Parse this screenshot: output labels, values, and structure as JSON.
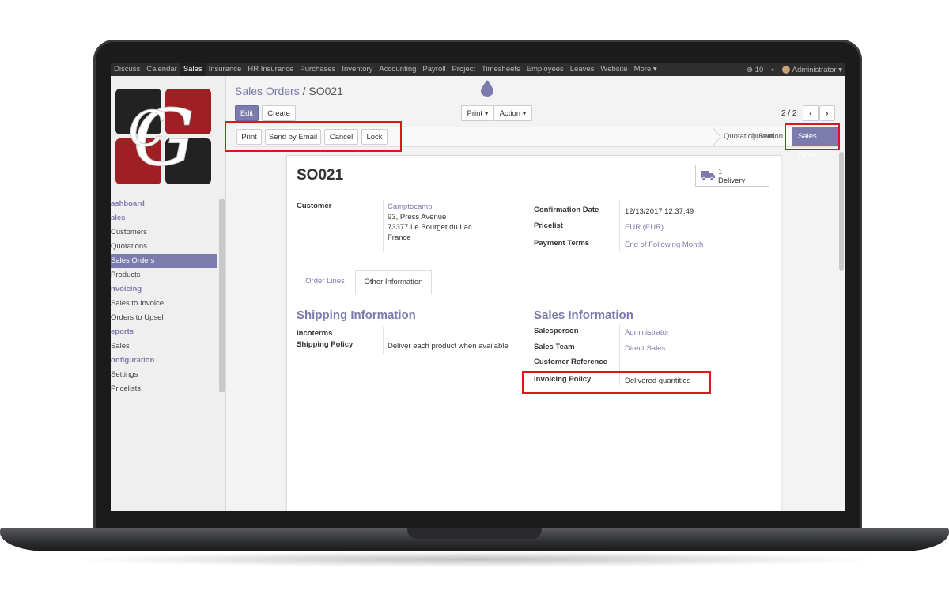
{
  "topnav": {
    "items": [
      "Discuss",
      "Calendar",
      "Sales",
      "Insurance",
      "HR Insurance",
      "Purchases",
      "Inventory",
      "Accounting",
      "Payroll",
      "Project",
      "Timesheets",
      "Employees",
      "Leaves",
      "Website",
      "More ▾"
    ],
    "active": "Sales",
    "messages_count": "10",
    "user": "Administrator ▾"
  },
  "sidebar": {
    "menu": [
      {
        "type": "section",
        "label": "ashboard"
      },
      {
        "type": "section",
        "label": "ales"
      },
      {
        "type": "link",
        "label": "Customers"
      },
      {
        "type": "link",
        "label": "Quotations"
      },
      {
        "type": "link",
        "label": "Sales Orders",
        "active": true
      },
      {
        "type": "link",
        "label": "Products"
      },
      {
        "type": "section",
        "label": "nvoicing"
      },
      {
        "type": "link",
        "label": "Sales to Invoice"
      },
      {
        "type": "link",
        "label": "Orders to Upsell"
      },
      {
        "type": "section",
        "label": "eports"
      },
      {
        "type": "link",
        "label": "Sales"
      },
      {
        "type": "section",
        "label": "onfiguration"
      },
      {
        "type": "link",
        "label": "Settings"
      },
      {
        "type": "link",
        "label": "Pricelists"
      }
    ]
  },
  "breadcrumb": {
    "parent": "Sales Orders",
    "sep": " / ",
    "current": "SO021"
  },
  "control": {
    "edit": "Edit",
    "create": "Create",
    "print": "Print ▾",
    "action": "Action ▾",
    "pager": "2 / 2",
    "prev": "‹",
    "next": "›"
  },
  "statusbar": {
    "buttons": [
      "Print",
      "Send by Email",
      "Cancel",
      "Lock"
    ],
    "stages": [
      "Quotation",
      "Quotation Sent",
      "Sales Order"
    ],
    "active_stage": "Sales Order"
  },
  "sheet": {
    "title": "SO021",
    "delivery_count": "1",
    "delivery_label": "Delivery",
    "customer_label": "Customer",
    "customer_name": "Camptocamp",
    "customer_address": [
      "93, Press Avenue",
      "73377 Le Bourget du Lac",
      "France"
    ],
    "confirmation_label": "Confirmation Date",
    "confirmation_value": "12/13/2017 12:37:49",
    "pricelist_label": "Pricelist",
    "pricelist_value": "EUR (EUR)",
    "payment_label": "Payment Terms",
    "payment_value": "End of Following Month",
    "tabs": [
      "Order Lines",
      "Other Information"
    ],
    "active_tab": "Other Information",
    "shipping": {
      "title": "Shipping Information",
      "incoterms_label": "Incoterms",
      "policy_label": "Shipping Policy",
      "policy_value": "Deliver each product when available"
    },
    "sales": {
      "title": "Sales Information",
      "salesperson_label": "Salesperson",
      "salesperson_value": "Administrator",
      "team_label": "Sales Team",
      "team_value": "Direct Sales",
      "ref_label": "Customer Reference",
      "invoicing_label": "Invoicing Policy",
      "invoicing_value": "Delivered quantities"
    }
  },
  "colors": {
    "accent": "#7c7bad",
    "highlight": "#e0141c",
    "nav": "#2e2e2e"
  }
}
